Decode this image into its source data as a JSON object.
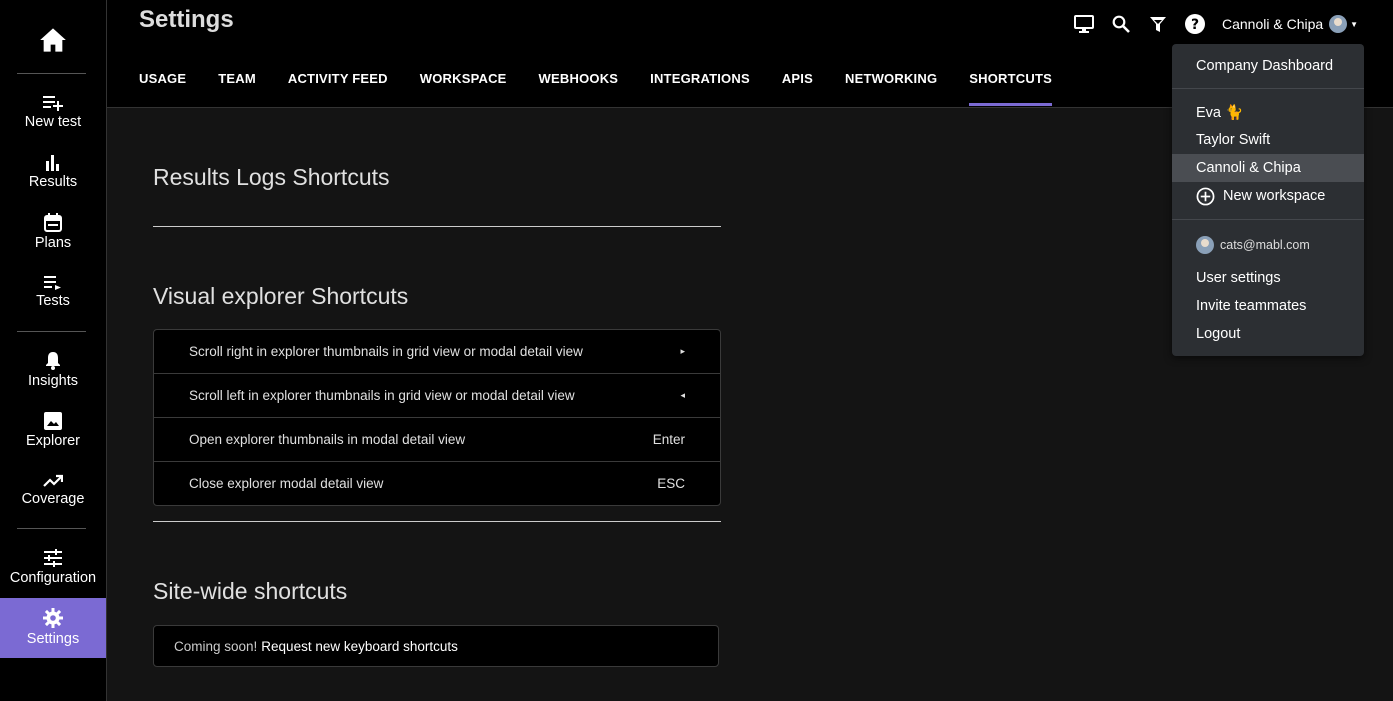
{
  "sidebar": {
    "items": [
      {
        "label": "New test",
        "icon": "playlist-add-icon"
      },
      {
        "label": "Results",
        "icon": "bar-chart-icon"
      },
      {
        "label": "Plans",
        "icon": "calendar-icon"
      },
      {
        "label": "Tests",
        "icon": "playlist-play-icon"
      },
      {
        "label": "Insights",
        "icon": "bell-icon"
      },
      {
        "label": "Explorer",
        "icon": "image-icon"
      },
      {
        "label": "Coverage",
        "icon": "trending-up-icon"
      },
      {
        "label": "Configuration",
        "icon": "tune-icon"
      },
      {
        "label": "Settings",
        "icon": "gear-icon"
      }
    ],
    "active": "Settings",
    "accent": "#7b6ad3"
  },
  "header": {
    "title": "Settings",
    "tabs": [
      "USAGE",
      "TEAM",
      "ACTIVITY FEED",
      "WORKSPACE",
      "WEBHOOKS",
      "INTEGRATIONS",
      "APIS",
      "NETWORKING",
      "SHORTCUTS"
    ],
    "active_tab": "SHORTCUTS",
    "workspace_name": "Cannoli & Chipa"
  },
  "main": {
    "results_logs_title": "Results Logs Shortcuts",
    "visual_explorer_title": "Visual explorer Shortcuts",
    "visual_explorer_rows": [
      {
        "description": "Scroll right in explorer thumbnails in grid view or modal detail view",
        "key": "▸"
      },
      {
        "description": "Scroll left in explorer thumbnails in grid view or modal detail view",
        "key": "◂"
      },
      {
        "description": "Open explorer thumbnails in modal detail view",
        "key": "Enter"
      },
      {
        "description": "Close explorer modal detail view",
        "key": "ESC"
      }
    ],
    "site_wide_title": "Site-wide shortcuts",
    "coming_soon": "Coming soon!",
    "request_link": "Request new keyboard shortcuts"
  },
  "dropdown": {
    "company_dashboard": "Company Dashboard",
    "workspaces": [
      "Eva 🐈",
      "Taylor Swift",
      "Cannoli & Chipa"
    ],
    "active_workspace": "Cannoli & Chipa",
    "new_workspace": "New workspace",
    "email": "cats@mabl.com",
    "user_settings": "User settings",
    "invite": "Invite teammates",
    "logout": "Logout"
  }
}
